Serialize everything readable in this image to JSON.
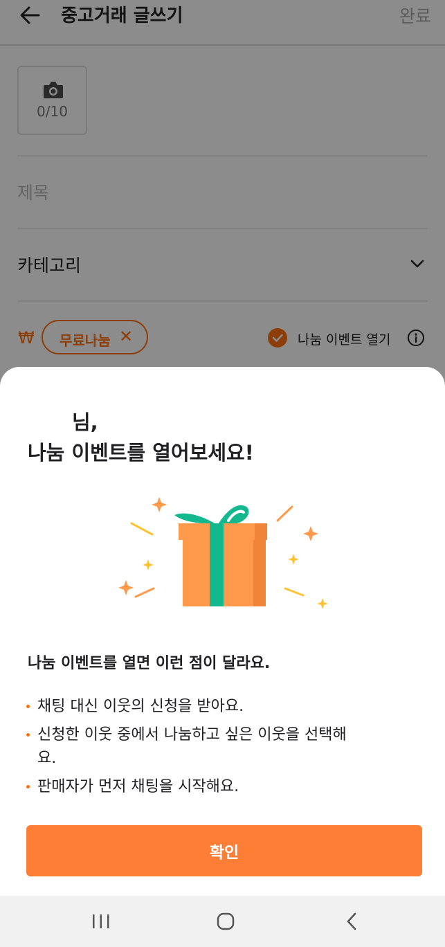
{
  "header": {
    "title": "중고거래 글쓰기",
    "done_label": "완료",
    "back_icon": "arrow-left-icon"
  },
  "form": {
    "photo_count": "0/10",
    "camera_icon": "camera-icon",
    "title_placeholder": "제목",
    "category_label": "카테고리",
    "currency_symbol": "₩",
    "free_chip_label": "무료나눔",
    "free_chip_remove": "✕",
    "event_checkbox_label": "나눔 이벤트 열기",
    "event_checkbox_checked": true
  },
  "sheet": {
    "greeting_line1": "님,",
    "greeting_line2": "나눔 이벤트를 열어보세요!",
    "benefit_title": "나눔 이벤트를 열면 이런 점이 달라요.",
    "benefits": [
      "채팅 대신 이웃의 신청을 받아요.",
      "신청한 이웃 중에서 나눔하고 싶은 이웃을 선택해요.",
      "판매자가 먼저 채팅을 시작해요."
    ],
    "confirm_label": "확인"
  },
  "system_nav": {
    "recent_icon": "recent-apps-icon",
    "home_icon": "home-icon",
    "back_icon": "system-back-icon"
  },
  "colors": {
    "accent": "#ff6f0f",
    "button": "#ff7e36",
    "ribbon": "#14b88f",
    "gift_box": "#ff9a4d"
  }
}
